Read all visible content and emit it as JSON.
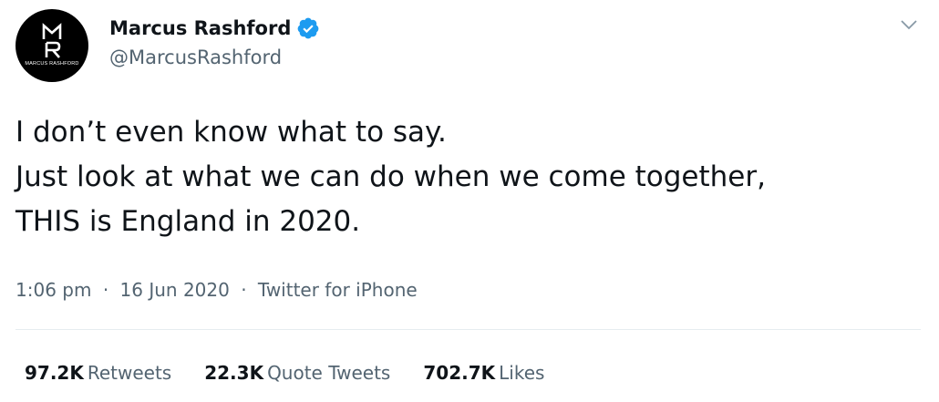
{
  "author": {
    "avatar_text": "MARCUS RASHFORD",
    "display_name": "Marcus Rashford",
    "handle": "@MarcusRashford",
    "verified": true
  },
  "tweet": {
    "lines": [
      "I don’t even know what to say.",
      "Just look at what we can do when we come together,",
      "THIS is England in 2020."
    ]
  },
  "meta": {
    "time": "1:06 pm",
    "date": "16 Jun 2020",
    "source": "Twitter for iPhone",
    "separator": "·"
  },
  "stats": {
    "retweets_count": "97.2K",
    "retweets_label": "Retweets",
    "quotes_count": "22.3K",
    "quotes_label": "Quote Tweets",
    "likes_count": "702.7K",
    "likes_label": "Likes"
  },
  "colors": {
    "verified": "#1d9bf0",
    "secondary_text": "#536471",
    "primary_text": "#0f1419"
  }
}
